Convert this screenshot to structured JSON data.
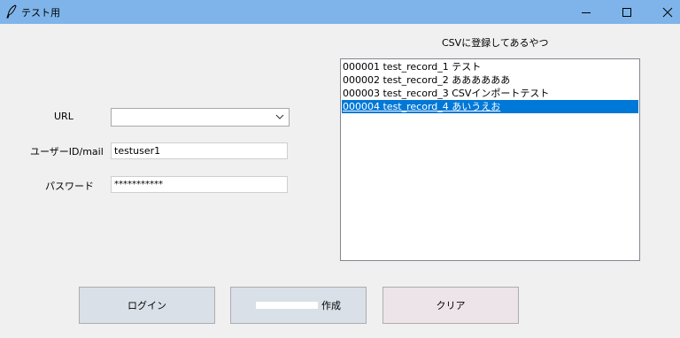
{
  "window": {
    "title": "テスト用",
    "icon": "feather-icon",
    "controls": [
      "minimize-icon",
      "maximize-icon",
      "close-icon"
    ]
  },
  "form": {
    "url_label": "URL",
    "url_value": "",
    "user_label": "ユーザーID/mail",
    "user_value": "testuser1",
    "password_label": "パスワード",
    "password_value": "***********"
  },
  "list": {
    "heading": "CSVに登録してあるやつ",
    "items": [
      "000001 test_record_1 テスト",
      "000002 test_record_2 ああああああ",
      "000003 test_record_3 CSVインポートテスト",
      "000004 test_record_4 あいうえお"
    ],
    "selected_index": 3
  },
  "buttons": {
    "login": "ログイン",
    "create_suffix": "作成",
    "clear": "クリア"
  },
  "colors": {
    "titlebar": "#7eb4ea",
    "selection": "#0078d7",
    "button_blue": "#dae0e8",
    "button_pink": "#ede4ea",
    "background": "#f0f0f0"
  }
}
